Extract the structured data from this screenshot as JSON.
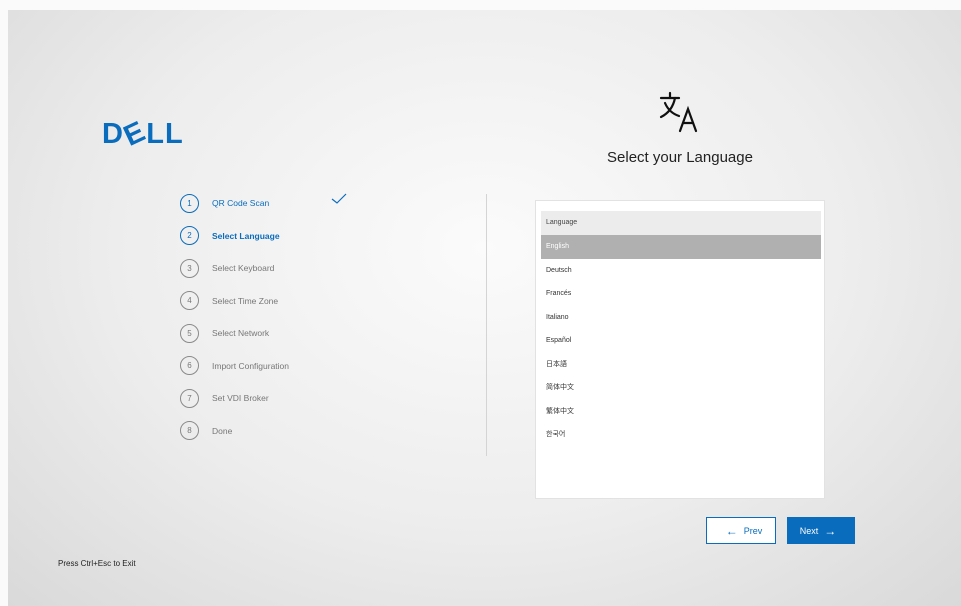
{
  "brand": {
    "logo_pre": "D",
    "logo_e": "E",
    "logo_post": "LL",
    "color": "#0a6cbd"
  },
  "icon": "translate-icon",
  "title": "Select your Language",
  "steps": [
    {
      "number": "1",
      "label": "QR Code Scan",
      "state": "done"
    },
    {
      "number": "2",
      "label": "Select Language",
      "state": "active"
    },
    {
      "number": "3",
      "label": "Select Keyboard",
      "state": "pending"
    },
    {
      "number": "4",
      "label": "Select Time Zone",
      "state": "pending"
    },
    {
      "number": "5",
      "label": "Select Network",
      "state": "pending"
    },
    {
      "number": "6",
      "label": "Import Configuration",
      "state": "pending"
    },
    {
      "number": "7",
      "label": "Set VDI Broker",
      "state": "pending"
    },
    {
      "number": "8",
      "label": "Done",
      "state": "pending"
    }
  ],
  "language_list": {
    "header": "Language",
    "selected": "English",
    "items": [
      "English",
      "Deutsch",
      "Francés",
      "Italiano",
      "Español",
      "日本語",
      "简体中文",
      "繁体中文",
      "한국어"
    ]
  },
  "buttons": {
    "prev": "Prev",
    "next": "Next"
  },
  "exit_hint": "Press Ctrl+Esc to Exit"
}
